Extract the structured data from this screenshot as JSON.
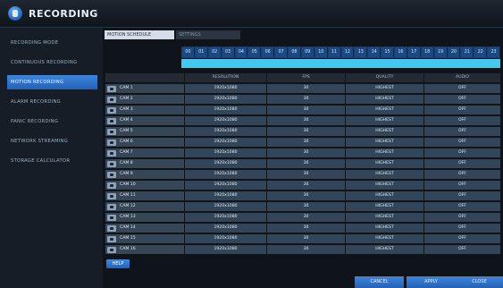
{
  "app": {
    "title": "RECORDING"
  },
  "sidebar": {
    "items": [
      {
        "label": "RECORDING MODE"
      },
      {
        "label": "CONTINUOUS RECORDING"
      },
      {
        "label": "MOTION RECORDING",
        "active": true
      },
      {
        "label": "ALARM RECORDING"
      },
      {
        "label": "PANIC RECORDING"
      },
      {
        "label": "NETWORK STREAMING"
      },
      {
        "label": "STORAGE CALCULATOR"
      }
    ]
  },
  "tabs": [
    {
      "label": "MOTION SCHEDULE",
      "active": true
    },
    {
      "label": "SETTINGS",
      "active": false
    }
  ],
  "hours": [
    "00",
    "01",
    "02",
    "03",
    "04",
    "05",
    "06",
    "07",
    "08",
    "09",
    "10",
    "11",
    "12",
    "13",
    "14",
    "15",
    "16",
    "17",
    "18",
    "19",
    "20",
    "21",
    "22",
    "23"
  ],
  "table": {
    "headers": [
      "",
      "RESOLUTION",
      "FPS",
      "QUALITY",
      "AUDIO"
    ],
    "rows": [
      [
        "CAM 1",
        "1920x1080",
        "30",
        "HIGHEST",
        "OFF"
      ],
      [
        "CAM 2",
        "1920x1080",
        "30",
        "HIGHEST",
        "OFF"
      ],
      [
        "CAM 3",
        "1920x1080",
        "30",
        "HIGHEST",
        "OFF"
      ],
      [
        "CAM 4",
        "1920x1080",
        "30",
        "HIGHEST",
        "OFF"
      ],
      [
        "CAM 5",
        "1920x1080",
        "30",
        "HIGHEST",
        "OFF"
      ],
      [
        "CAM 6",
        "1920x1080",
        "30",
        "HIGHEST",
        "OFF"
      ],
      [
        "CAM 7",
        "1920x1080",
        "30",
        "HIGHEST",
        "OFF"
      ],
      [
        "CAM 8",
        "1920x1080",
        "30",
        "HIGHEST",
        "OFF"
      ],
      [
        "CAM 9",
        "1920x1080",
        "30",
        "HIGHEST",
        "OFF"
      ],
      [
        "CAM 10",
        "1920x1080",
        "30",
        "HIGHEST",
        "OFF"
      ],
      [
        "CAM 11",
        "1920x1080",
        "30",
        "HIGHEST",
        "OFF"
      ],
      [
        "CAM 12",
        "1920x1080",
        "30",
        "HIGHEST",
        "OFF"
      ],
      [
        "CAM 13",
        "1920x1080",
        "30",
        "HIGHEST",
        "OFF"
      ],
      [
        "CAM 14",
        "1920x1080",
        "30",
        "HIGHEST",
        "OFF"
      ],
      [
        "CAM 15",
        "1920x1080",
        "30",
        "HIGHEST",
        "OFF"
      ],
      [
        "CAM 16",
        "1920x1080",
        "30",
        "HIGHEST",
        "OFF"
      ]
    ]
  },
  "help_label": "HELP",
  "footer": {
    "cancel": "CANCEL",
    "apply": "APPLY",
    "close": "CLOSE"
  }
}
